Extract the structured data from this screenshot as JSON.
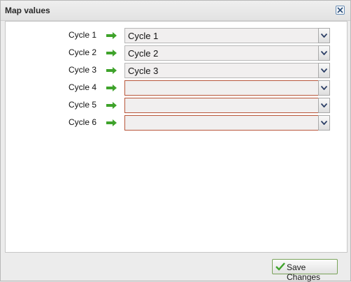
{
  "dialog": {
    "title": "Map values",
    "save_label": "Save Changes"
  },
  "rows": [
    {
      "label": "Cycle 1",
      "value": "Cycle 1",
      "invalid": false
    },
    {
      "label": "Cycle 2",
      "value": "Cycle 2",
      "invalid": false
    },
    {
      "label": "Cycle 3",
      "value": "Cycle 3",
      "invalid": false
    },
    {
      "label": "Cycle 4",
      "value": "",
      "invalid": true
    },
    {
      "label": "Cycle 5",
      "value": "",
      "invalid": true
    },
    {
      "label": "Cycle 6",
      "value": "",
      "invalid": true
    }
  ],
  "colors": {
    "arrow": "#3fa32b",
    "invalid_border": "#b8563a",
    "accent": "#6b8fb5"
  },
  "icons": {
    "close": "close-icon",
    "arrow": "arrow-right-icon",
    "dropdown": "chevron-down-icon",
    "save": "check-icon"
  }
}
